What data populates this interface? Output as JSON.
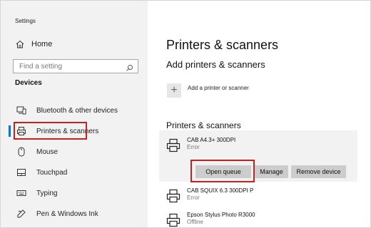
{
  "app": {
    "title": "Settings"
  },
  "sidebar": {
    "home_label": "Home",
    "search_placeholder": "Find a setting",
    "section_label": "Devices",
    "items": [
      {
        "label": "Bluetooth & other devices",
        "icon": "bluetooth-devices-icon"
      },
      {
        "label": "Printers & scanners",
        "icon": "printer-icon",
        "selected": true
      },
      {
        "label": "Mouse",
        "icon": "mouse-icon"
      },
      {
        "label": "Touchpad",
        "icon": "touchpad-icon"
      },
      {
        "label": "Typing",
        "icon": "keyboard-icon"
      },
      {
        "label": "Pen & Windows Ink",
        "icon": "pen-icon"
      }
    ]
  },
  "main": {
    "title": "Printers & scanners",
    "add_section_title": "Add printers & scanners",
    "add_label": "Add a printer or scanner",
    "list_title": "Printers & scanners",
    "printers": [
      {
        "name": "CAB A4.3+ 300DPI",
        "status": "Error"
      },
      {
        "name": "CAB SQUIX 6.3 300DPI P",
        "status": "Error"
      },
      {
        "name": "Epson Stylus Photo R3000",
        "status": "Offline"
      }
    ],
    "buttons": {
      "open_queue": "Open queue",
      "manage": "Manage",
      "remove_device": "Remove device"
    }
  },
  "colors": {
    "accent": "#0078d7",
    "highlight": "#c8201d"
  }
}
